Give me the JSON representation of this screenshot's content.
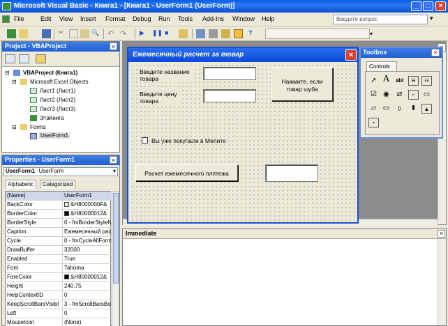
{
  "window": {
    "title": "Microsoft Visual Basic - Книга1 - [Книга1 - UserForm1 (UserForm)]"
  },
  "menubar": {
    "items": [
      "File",
      "Edit",
      "View",
      "Insert",
      "Format",
      "Debug",
      "Run",
      "Tools",
      "Add-Ins",
      "Window",
      "Help"
    ],
    "help_placeholder": "Введите вопрос"
  },
  "project": {
    "title": "Project - VBAProject",
    "tree": [
      "VBAProject (Книга1)",
      "Microsoft Excel Objects",
      "Лист1 (Лист1)",
      "Лист2 (Лист2)",
      "Лист3 (Лист3)",
      "ЭтаКнига",
      "Forms",
      "UserForm1"
    ]
  },
  "properties": {
    "title": "Properties - UserForm1",
    "object_name": "UserForm1",
    "object_type": "UserForm",
    "tabs": [
      "Alphabetic",
      "Categorized"
    ],
    "rows": [
      {
        "name": "(Name)",
        "value": "UserForm1"
      },
      {
        "name": "BackColor",
        "value": "&H8000000F&"
      },
      {
        "name": "BorderColor",
        "value": "&H80000012&"
      },
      {
        "name": "BorderStyle",
        "value": "0 - fmBorderStyleN"
      },
      {
        "name": "Caption",
        "value": "Ежемесячный рас"
      },
      {
        "name": "Cycle",
        "value": "0 - fmCycleAllForm"
      },
      {
        "name": "DrawBuffer",
        "value": "32000"
      },
      {
        "name": "Enabled",
        "value": "True"
      },
      {
        "name": "Font",
        "value": "Tahoma"
      },
      {
        "name": "ForeColor",
        "value": "&H80000012&"
      },
      {
        "name": "Height",
        "value": "240,75"
      },
      {
        "name": "HelpContextID",
        "value": "0"
      },
      {
        "name": "KeepScrollBarsVisibl",
        "value": "3 - fmScrollBarsBo"
      },
      {
        "name": "Left",
        "value": "0"
      },
      {
        "name": "MouseIcon",
        "value": "(None)"
      }
    ],
    "swatch_colors": {
      "BackColor": "#ece9d8",
      "BorderColor": "#000000",
      "ForeColor": "#000000"
    }
  },
  "userform": {
    "title": "Ежемесячный расчет за товар",
    "label_name": "Введите название товара",
    "label_price": "Введите цену товара",
    "button_click": "Нажмите, если товар шуба",
    "checkbox_label": "Вы уже покупали в Мелите",
    "button_calc": "Расчет ежемесячного плптежа"
  },
  "toolbox": {
    "title": "Toolbox",
    "tab": "Controls"
  },
  "immediate": {
    "title": "Immediate"
  },
  "colors": {
    "titlebar": "#0a5ee8",
    "form_border": "#1a4fc8",
    "close_red": "#d8452e"
  }
}
